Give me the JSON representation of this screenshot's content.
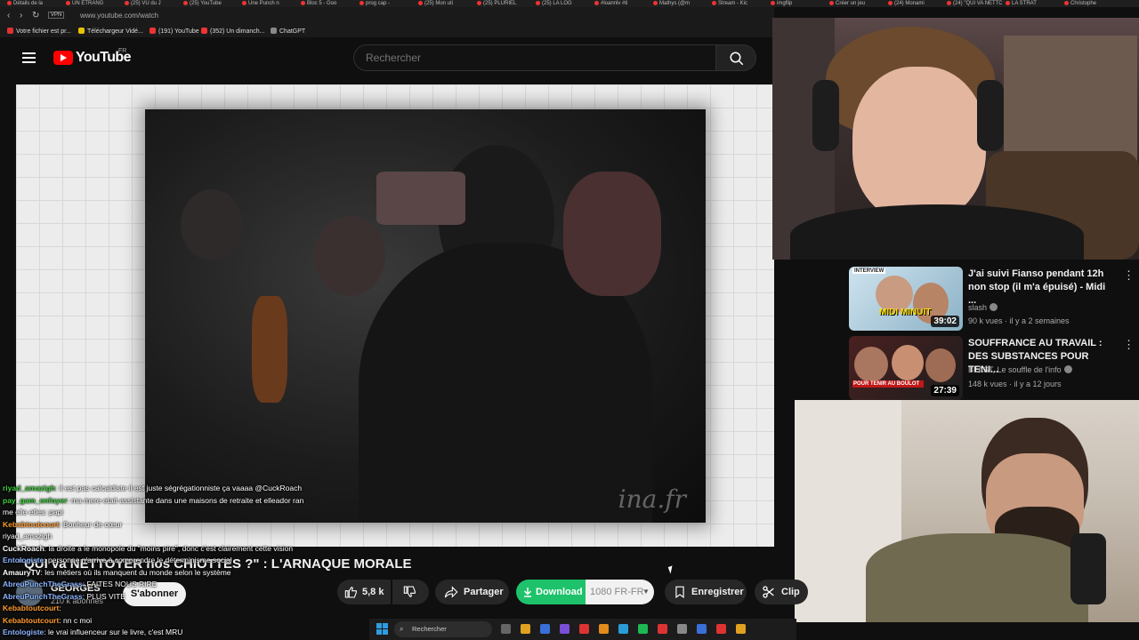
{
  "browser": {
    "url": "www.youtube.com/watch",
    "vpn_label": "VPN",
    "tabs": [
      "Détails de la",
      "UN ÉTRANG",
      "(25) VU du J",
      "(25) YouTube",
      "Une Punch n",
      "Bloc 5 - Goo",
      "prog cap -",
      "(25) Mon uti",
      "(25) PLURIEL",
      "(25) LA LOG",
      "#loannlv #ti",
      "Mathys (@m",
      "Stream - Kic",
      "imgflip",
      "Créer un jeu",
      "(24) Monami",
      "(24) \"QUI VA NETTOY",
      "LA STRAT",
      "Christophe"
    ],
    "bookmarks": [
      "Votre fichier est pr...",
      "Téléchargeur Vidé...",
      "(191) YouTube",
      "(352) Un dimanch...",
      "ChatGPT"
    ]
  },
  "header": {
    "logo_text": "YouTube",
    "region": "FR",
    "search_placeholder": "Rechercher"
  },
  "player": {
    "watermark": "ina.fr"
  },
  "video": {
    "title": "\"QUI va NETTOYER nos CHIOTTES ?\" : L'ARNAQUE MORALE",
    "channel": "GEORGES",
    "subs": "210 k abonnés",
    "subscribe": "S'abonner",
    "likes": "5,8 k",
    "share": "Partager",
    "download": "Download",
    "quality": "1080 FR-FR",
    "save": "Enregistrer",
    "clip": "Clip"
  },
  "recommended": [
    {
      "title": "J'ai suivi Fianso pendant 12h non stop (il m'a épuisé) - Midi ...",
      "channel": "slash",
      "meta": "90 k vues · il y a 2 semaines",
      "duration": "39:02",
      "thumb_text": "MIDI MINUIT",
      "badge": "INTERVIEW"
    },
    {
      "title": "SOUFFRANCE AU TRAVAIL : DES SUBSTANCES POUR TENI...",
      "channel": "BLAST, Le souffle de l'info",
      "meta": "148 k vues · il y a 12 jours",
      "duration": "27:39",
      "thumb_text": "POUR TENIR AU BOULOT"
    }
  ],
  "chat": [
    {
      "user": "riyad_amazigh",
      "text": ": il est pas calcaidiste il est juste ségrégationniste ça vaaaa @CuckRoach",
      "color": "#3ecf3e"
    },
    {
      "user": "pay_gam_enfoyer",
      "text": ": ma mere etait assistante dans une maisons de retraite et elleador ran",
      "color": "#3ecf3e"
    },
    {
      "user": "",
      "text": "me elle elles: papi",
      "color": "#ffffff"
    },
    {
      "user": "Kebabtoutcourt",
      "text": ": Bonheur de cœur",
      "color": "#ff9b2f"
    },
    {
      "user": "",
      "text": "riyad_amazigh",
      "color": "#9aa7ff"
    },
    {
      "user": "CuckRoach",
      "text": ": la droite a le monopole du \"moins pire\", donc c'est clairement cette vision",
      "color": "#ffffff"
    },
    {
      "user": "Entologiste",
      "text": ": personne n'arrive à comprendre le déterminisme social",
      "color": "#8ab4ff"
    },
    {
      "user": "AmauryTV",
      "text": ": les métiers où ils manquent du monde selon le système",
      "color": "#ffffff"
    },
    {
      "user": "AbreuPunchTheGrass",
      "text": ": FAITES NOUS RIRE",
      "color": "#8ab4ff"
    },
    {
      "user": "AbreuPunchTheGrass",
      "text": ": PLUS VITE",
      "color": "#8ab4ff"
    },
    {
      "user": "Kebabtoutcourt",
      "text": ":",
      "color": "#ff9b2f"
    },
    {
      "user": "Kebabtoutcourt",
      "text": ": nn c moi",
      "color": "#ff9b2f"
    },
    {
      "user": "Entologiste",
      "text": ": le vrai influenceur sur le livre, c'est MRU",
      "color": "#8ab4ff"
    }
  ],
  "taskbar": {
    "search_placeholder": "Rechercher"
  }
}
